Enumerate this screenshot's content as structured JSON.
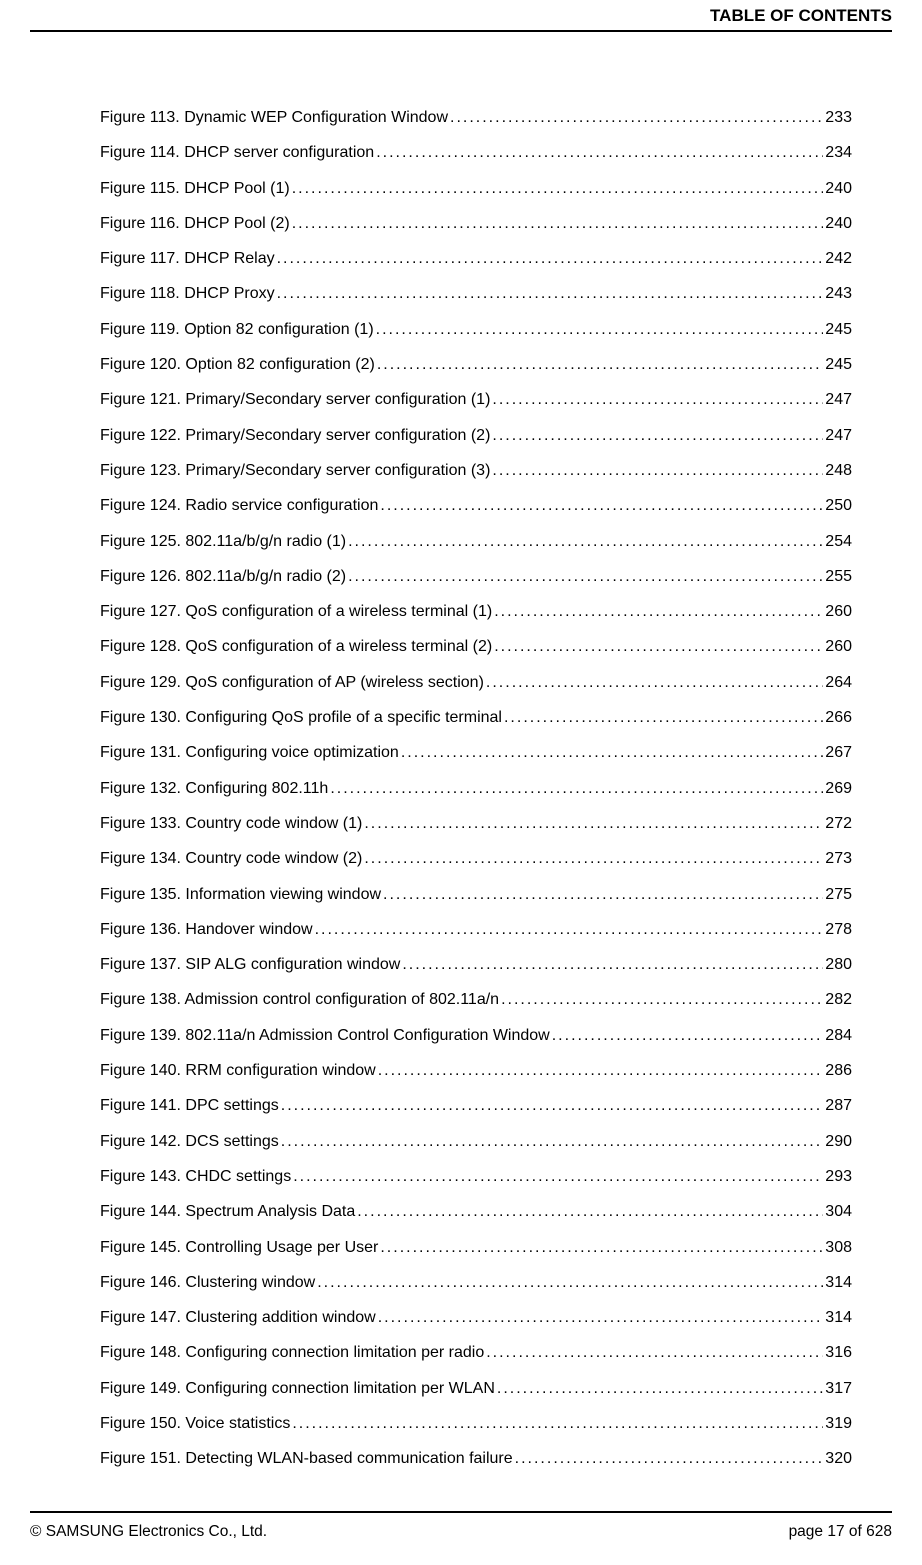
{
  "header": "TABLE OF CONTENTS",
  "entries": [
    {
      "title": "Figure 113. Dynamic WEP Configuration Window",
      "page": "233"
    },
    {
      "title": "Figure 114. DHCP server configuration",
      "page": "234"
    },
    {
      "title": "Figure 115. DHCP Pool (1)",
      "page": "240"
    },
    {
      "title": "Figure 116. DHCP Pool (2)",
      "page": "240"
    },
    {
      "title": "Figure 117. DHCP Relay",
      "page": "242"
    },
    {
      "title": "Figure 118. DHCP Proxy",
      "page": "243"
    },
    {
      "title": "Figure 119. Option 82 configuration (1)",
      "page": "245"
    },
    {
      "title": "Figure 120. Option 82 configuration (2)",
      "page": "245"
    },
    {
      "title": "Figure 121. Primary/Secondary server configuration (1)",
      "page": "247"
    },
    {
      "title": "Figure 122. Primary/Secondary server configuration (2)",
      "page": "247"
    },
    {
      "title": "Figure 123. Primary/Secondary server configuration (3)",
      "page": "248"
    },
    {
      "title": "Figure 124. Radio service configuration",
      "page": "250"
    },
    {
      "title": "Figure 125. 802.11a/b/g/n radio (1)",
      "page": "254"
    },
    {
      "title": "Figure 126. 802.11a/b/g/n radio (2)",
      "page": "255"
    },
    {
      "title": "Figure 127. QoS configuration of a wireless terminal (1)",
      "page": "260"
    },
    {
      "title": "Figure 128. QoS configuration of a wireless terminal (2)",
      "page": "260"
    },
    {
      "title": "Figure 129. QoS configuration of AP (wireless section)",
      "page": "264"
    },
    {
      "title": "Figure 130. Configuring QoS profile of a specific terminal",
      "page": "266"
    },
    {
      "title": "Figure 131. Configuring voice optimization",
      "page": "267"
    },
    {
      "title": "Figure 132. Configuring 802.11h",
      "page": "269"
    },
    {
      "title": "Figure 133. Country code window (1)",
      "page": "272"
    },
    {
      "title": "Figure 134. Country code window (2)",
      "page": "273"
    },
    {
      "title": "Figure 135. Information viewing window",
      "page": "275"
    },
    {
      "title": "Figure 136. Handover window",
      "page": "278"
    },
    {
      "title": "Figure 137. SIP ALG configuration window",
      "page": "280"
    },
    {
      "title": "Figure 138. Admission control configuration of 802.11a/n",
      "page": "282"
    },
    {
      "title": "Figure 139. 802.11a/n Admission Control Configuration Window",
      "page": "284"
    },
    {
      "title": "Figure 140. RRM configuration window",
      "page": "286"
    },
    {
      "title": "Figure 141. DPC settings",
      "page": "287"
    },
    {
      "title": "Figure 142. DCS settings",
      "page": "290"
    },
    {
      "title": "Figure 143. CHDC settings",
      "page": "293"
    },
    {
      "title": "Figure 144. Spectrum Analysis Data",
      "page": "304"
    },
    {
      "title": "Figure 145. Controlling Usage per User",
      "page": "308"
    },
    {
      "title": "Figure 146. Clustering window",
      "page": "314"
    },
    {
      "title": "Figure 147. Clustering addition window",
      "page": "314"
    },
    {
      "title": "Figure 148. Configuring connection limitation per radio",
      "page": "316"
    },
    {
      "title": "Figure 149. Configuring connection limitation per WLAN",
      "page": "317"
    },
    {
      "title": "Figure 150. Voice statistics",
      "page": "319"
    },
    {
      "title": "Figure 151. Detecting WLAN-based communication failure",
      "page": "320"
    }
  ],
  "footer": {
    "left": "© SAMSUNG Electronics Co., Ltd.",
    "right": "page 17 of 628"
  }
}
